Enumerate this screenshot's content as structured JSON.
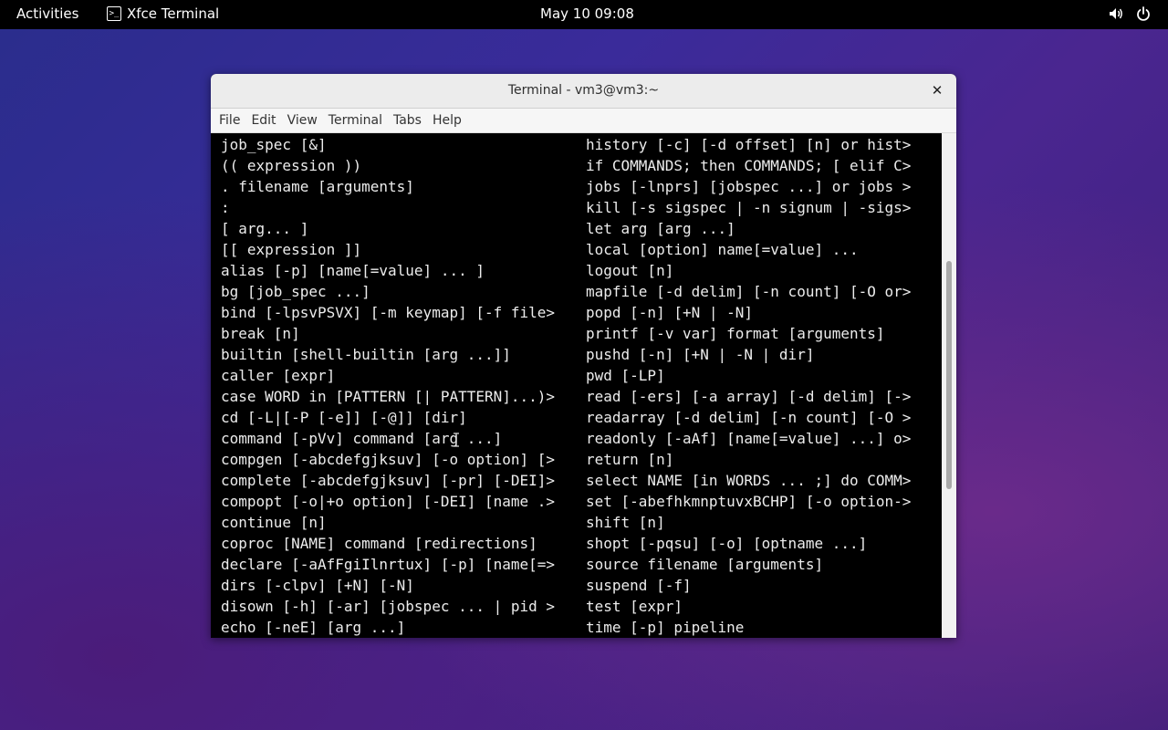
{
  "topbar": {
    "activities": "Activities",
    "app_name": "Xfce Terminal",
    "app_icon": ">_",
    "clock": "May 10  09:08",
    "tray_icons": [
      "volume-icon",
      "power-icon"
    ]
  },
  "window": {
    "title": "Terminal - vm3@vm3:~",
    "close_glyph": "✕",
    "menu": [
      "File",
      "Edit",
      "View",
      "Terminal",
      "Tabs",
      "Help"
    ]
  },
  "terminal": {
    "left_column": [
      "job_spec [&]",
      "(( expression ))",
      ". filename [arguments]",
      ":",
      "[ arg... ]",
      "[[ expression ]]",
      "alias [-p] [name[=value] ... ]",
      "bg [job_spec ...]",
      "bind [-lpsvPSVX] [-m keymap] [-f file>",
      "break [n]",
      "builtin [shell-builtin [arg ...]]",
      "caller [expr]",
      "case WORD in [PATTERN [| PATTERN]...)>",
      "cd [-L|[-P [-e]] [-@]] [dir]",
      "command [-pVv] command [arg ...]",
      "compgen [-abcdefgjksuv] [-o option] [>",
      "complete [-abcdefgjksuv] [-pr] [-DEI]>",
      "compopt [-o|+o option] [-DEI] [name .>",
      "continue [n]",
      "coproc [NAME] command [redirections]",
      "declare [-aAfFgiIlnrtux] [-p] [name[=>",
      "dirs [-clpv] [+N] [-N]",
      "disown [-h] [-ar] [jobspec ... | pid >",
      "echo [-neE] [arg ...]"
    ],
    "right_column": [
      "history [-c] [-d offset] [n] or hist>",
      "if COMMANDS; then COMMANDS; [ elif C>",
      "jobs [-lnprs] [jobspec ...] or jobs >",
      "kill [-s sigspec | -n signum | -sigs>",
      "let arg [arg ...]",
      "local [option] name[=value] ...",
      "logout [n]",
      "mapfile [-d delim] [-n count] [-O or>",
      "popd [-n] [+N | -N]",
      "printf [-v var] format [arguments]",
      "pushd [-n] [+N | -N | dir]",
      "pwd [-LP]",
      "read [-ers] [-a array] [-d delim] [->",
      "readarray [-d delim] [-n count] [-O >",
      "readonly [-aAf] [name[=value] ...] o>",
      "return [n]",
      "select NAME [in WORDS ... ;] do COMM>",
      "set [-abefhkmnptuvxBCHP] [-o option->",
      "shift [n]",
      "shopt [-pqsu] [-o] [optname ...]",
      "source filename [arguments]",
      "suspend [-f]",
      "test [expr]",
      "time [-p] pipeline"
    ]
  }
}
